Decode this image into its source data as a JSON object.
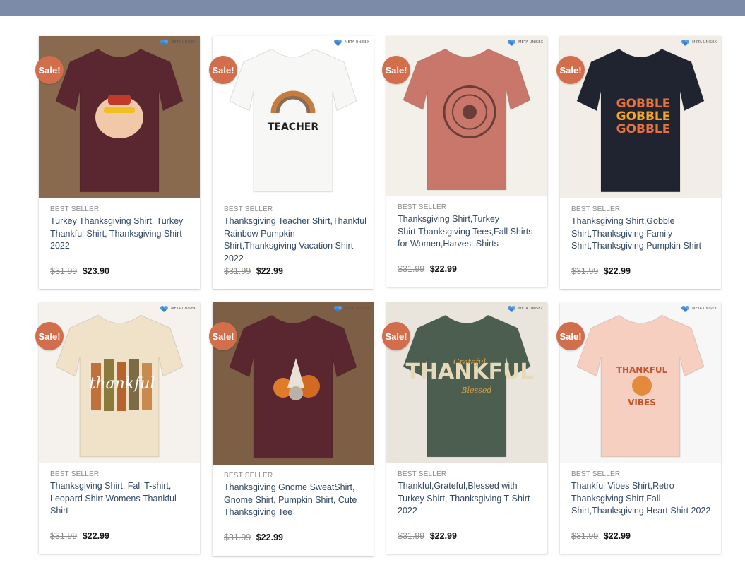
{
  "colors": {
    "topbar": "#7a8ca8",
    "sale_badge": "#d26e4b",
    "title_link": "#334862"
  },
  "brand_label": "META UNISEX",
  "sale_label": "Sale!",
  "products": [
    {
      "category": "BEST SELLER",
      "title": "Turkey Thanksgiving Shirt, Turkey Thankful Shirt, Thanksgiving Shirt 2022",
      "old_price": "$31.99",
      "new_price": "$23.90",
      "shirt_color": "#5a2630",
      "bg": "#8a6a4e",
      "print": "turkey"
    },
    {
      "category": "BEST SELLER",
      "title": "Thanksgiving Teacher Shirt,Thankful Rainbow Pumpkin Shirt,Thanksgiving Vacation Shirt 2022",
      "old_price": "$31.99",
      "new_price": "$22.99",
      "shirt_color": "#f7f7f5",
      "bg": "#ffffff",
      "print": "teacher"
    },
    {
      "category": "BEST SELLER",
      "title": "Thanksgiving Shirt,Turkey Shirt,Thanksgiving Tees,Fall Shirts for Women,Harvest Shirts",
      "old_price": "$31.99",
      "new_price": "$22.99",
      "shirt_color": "#c9776b",
      "bg": "#f3efe9",
      "print": "circle"
    },
    {
      "category": "BEST SELLER",
      "title": "Thanksgiving Shirt,Gobble Shirt,Thanksgiving Family Shirt,Thanksgiving Pumpkin Shirt",
      "old_price": "$31.99",
      "new_price": "$22.99",
      "shirt_color": "#1f2430",
      "bg": "#f2ede6",
      "print": "gobble"
    },
    {
      "category": "BEST SELLER",
      "title": "Thanksgiving Shirt, Fall T-shirt, Leopard Shirt Womens Thankful Shirt",
      "old_price": "$31.99",
      "new_price": "$22.99",
      "shirt_color": "#efe2c9",
      "bg": "#f5f1ec",
      "print": "thankful"
    },
    {
      "category": "BEST SELLER",
      "title": "Thanksgiving Gnome SweatShirt, Gnome Shirt, Pumpkin Shirt, Cute Thanksgiving Tee",
      "old_price": "$31.99",
      "new_price": "$22.99",
      "shirt_color": "#5a2630",
      "bg": "#7d5f46",
      "print": "gnome"
    },
    {
      "category": "BEST SELLER",
      "title": "Thankful,Grateful,Blessed with Turkey Shirt, Thanksgiving T-Shirt 2022",
      "old_price": "$31.99",
      "new_price": "$22.99",
      "shirt_color": "#4b5e50",
      "bg": "#e9e4dc",
      "print": "tgb"
    },
    {
      "category": "BEST SELLER",
      "title": "Thankful Vibes Shirt,Retro Thanksgiving Shirt,Fall Shirt,Thanksgiving Heart Shirt 2022",
      "old_price": "$31.99",
      "new_price": "$22.99",
      "shirt_color": "#f6cfc0",
      "bg": "#f7f7f7",
      "print": "vibes"
    }
  ]
}
